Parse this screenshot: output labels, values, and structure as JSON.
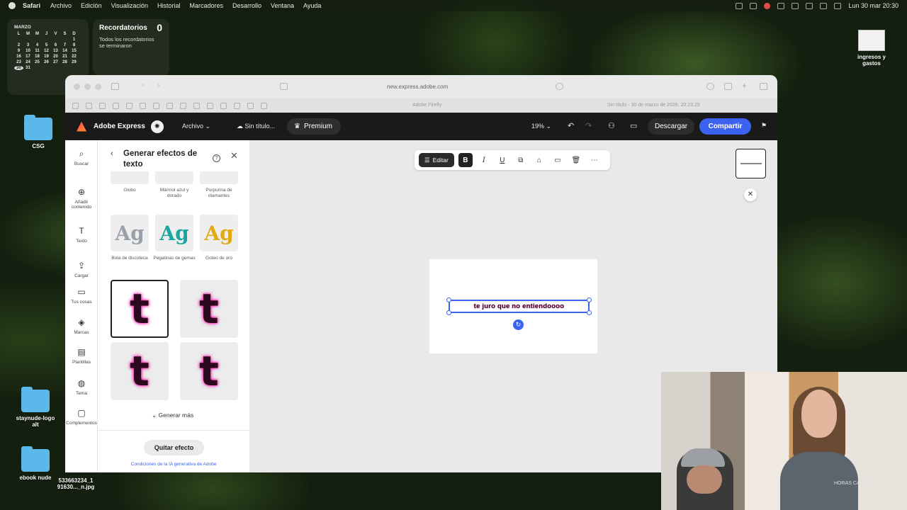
{
  "menubar": {
    "app": "Safari",
    "items": [
      "Archivo",
      "Edición",
      "Visualización",
      "Historial",
      "Marcadores",
      "Desarrollo",
      "Ventana",
      "Ayuda"
    ],
    "clock": "Lun 30 mar  20:30"
  },
  "calendar": {
    "month": "MARZO",
    "weekdays": [
      "L",
      "M",
      "M",
      "J",
      "V",
      "S",
      "D"
    ],
    "days": [
      "",
      "",
      "",
      "",
      "",
      "",
      "1",
      "2",
      "3",
      "4",
      "5",
      "6",
      "7",
      "8",
      "9",
      "10",
      "11",
      "12",
      "13",
      "14",
      "15",
      "16",
      "17",
      "18",
      "19",
      "20",
      "21",
      "22",
      "23",
      "24",
      "25",
      "26",
      "27",
      "28",
      "29",
      "30",
      "31"
    ],
    "today": "30"
  },
  "reminders": {
    "title": "Recordatorios",
    "count": "0",
    "subtitle": "Todos los recordatorios se terminaron"
  },
  "desktop": {
    "csg": "CSG",
    "ingresos": "ingresos y gastos",
    "staynude": "staynude-logo alt",
    "ebook": "ebook nude",
    "jpg": "533663234_1 91630..._n.jpg"
  },
  "browser": {
    "url": "new.express.adobe.com",
    "tab1": "Adobe Firefly",
    "tab2": "Sin título - 30 de marzo de 2026, 20.23.29"
  },
  "express": {
    "brand": "Adobe Express",
    "archivo": "Archivo",
    "doc": "Sin título...",
    "premium": "Premium",
    "zoom": "19%",
    "descargar": "Descargar",
    "compartir": "Compartir"
  },
  "rail": [
    {
      "icon": "search-icon",
      "label": "Buscar"
    },
    {
      "icon": "add-icon",
      "label": "Añadir contenido"
    },
    {
      "icon": "text-icon",
      "label": "Texto"
    },
    {
      "icon": "upload-icon",
      "label": "Cargar"
    },
    {
      "icon": "folder-icon",
      "label": "Tus cosas"
    },
    {
      "icon": "brand-icon",
      "label": "Marcas"
    },
    {
      "icon": "template-icon",
      "label": "Plantillas"
    },
    {
      "icon": "palette-icon",
      "label": "Tema"
    },
    {
      "icon": "addons-icon",
      "label": "Complementos"
    }
  ],
  "panel": {
    "title": "Generar efectos de texto",
    "top_labels": [
      "Globo",
      "Mármol azul y dorado",
      "Purpurina de diamantes"
    ],
    "styles": [
      {
        "glyph": "Ag",
        "label": "Bola de discoteca",
        "color": "#9aa0a8"
      },
      {
        "glyph": "Ag",
        "label": "Pegatinas de gemas",
        "color": "#19a7a0"
      },
      {
        "glyph": "Ag",
        "label": "Goteo de oro",
        "color": "#e0a915"
      }
    ],
    "results_glyph": "t",
    "generate_more": "Generar más",
    "remove": "Quitar efecto",
    "terms": "Condiciones de la IA generativa de Adobe"
  },
  "toolbar": {
    "edit": "Editar",
    "bold": "B",
    "italic": "I",
    "underline": "U"
  },
  "canvas": {
    "text": "te juro que no entiendoooo"
  },
  "webcam": {
    "caption": "HORAS CARO"
  }
}
